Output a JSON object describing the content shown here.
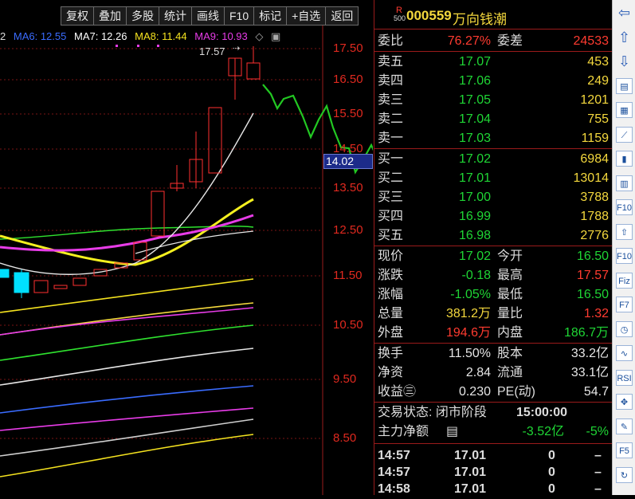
{
  "toolbar": {
    "buttons": [
      "复权",
      "叠加",
      "多股",
      "统计",
      "画线",
      "F10",
      "标记",
      "+自选",
      "返回"
    ]
  },
  "ma_legend": {
    "prefix": "2",
    "ma6_label": "MA6: 12.55",
    "ma7_label": "MA7: 12.26",
    "ma8_label": "MA8: 11.44",
    "ma9_label": "MA9: 10.93",
    "colors": {
      "ma6": "#3a6cff",
      "ma7": "#ffffff",
      "ma8": "#f4e21f",
      "ma9": "#e83ce8"
    }
  },
  "chart": {
    "high_marker": "17.57",
    "current_price_tag": "14.02",
    "price_axis": [
      "17.50",
      "16.50",
      "15.50",
      "14.50",
      "13.50",
      "12.50",
      "11.50",
      "10.50",
      "9.50",
      "8.50"
    ]
  },
  "quote": {
    "r_badge": "R",
    "r_sub": "500",
    "code": "000559",
    "name": "万向钱潮",
    "weibi_label": "委比",
    "weibi_value": "76.27%",
    "weicha_label": "委差",
    "weicha_value": "24533",
    "asks": [
      {
        "label": "卖五",
        "price": "17.07",
        "vol": "453"
      },
      {
        "label": "卖四",
        "price": "17.06",
        "vol": "249"
      },
      {
        "label": "卖三",
        "price": "17.05",
        "vol": "1201"
      },
      {
        "label": "卖二",
        "price": "17.04",
        "vol": "755"
      },
      {
        "label": "卖一",
        "price": "17.03",
        "vol": "1159"
      }
    ],
    "bids": [
      {
        "label": "买一",
        "price": "17.02",
        "vol": "6984"
      },
      {
        "label": "买二",
        "price": "17.01",
        "vol": "13014"
      },
      {
        "label": "买三",
        "price": "17.00",
        "vol": "3788"
      },
      {
        "label": "买四",
        "price": "16.99",
        "vol": "1788"
      },
      {
        "label": "买五",
        "price": "16.98",
        "vol": "2776"
      }
    ],
    "stats": [
      {
        "l1": "现价",
        "v1": "17.02",
        "c1": "green",
        "l2": "今开",
        "v2": "16.50",
        "c2": "green"
      },
      {
        "l1": "涨跌",
        "v1": "-0.18",
        "c1": "green",
        "l2": "最高",
        "v2": "17.57",
        "c2": "red"
      },
      {
        "l1": "涨幅",
        "v1": "-1.05%",
        "c1": "green",
        "l2": "最低",
        "v2": "16.50",
        "c2": "green"
      },
      {
        "l1": "总量",
        "v1": "381.2万",
        "c1": "yellow",
        "l2": "量比",
        "v2": "1.32",
        "c2": "red"
      },
      {
        "l1": "外盘",
        "v1": "194.6万",
        "c1": "red",
        "l2": "内盘",
        "v2": "186.7万",
        "c2": "green"
      }
    ],
    "stats2": [
      {
        "l1": "换手",
        "v1": "11.50%",
        "l2": "股本",
        "v2": "33.2亿"
      },
      {
        "l1": "净资",
        "v1": "2.84",
        "l2": "流通",
        "v2": "33.1亿"
      },
      {
        "l1": "收益㊂",
        "v1": "0.230",
        "l2": "PE(动)",
        "v2": "54.7"
      }
    ],
    "trade_status_label": "交易状态: 闭市阶段",
    "trade_status_time": "15:00:00",
    "main_flow_label": "主力净额",
    "main_flow_value": "-3.52亿",
    "main_flow_pct": "-5%",
    "ticks": [
      {
        "time": "14:57",
        "price": "17.01",
        "vol": "0",
        "dir": "–"
      },
      {
        "time": "14:57",
        "price": "17.01",
        "vol": "0",
        "dir": "–"
      },
      {
        "time": "14:58",
        "price": "17.01",
        "vol": "0",
        "dir": "–"
      }
    ]
  },
  "sidebar": {
    "icons": [
      "arrow-left-icon",
      "arrow-up-icon",
      "arrow-down-icon",
      "list-icon",
      "grid-icon",
      "trend-icon",
      "candles-icon",
      "table-icon",
      "f10-icon",
      "f9-icon",
      "f10b-icon",
      "fiz-icon",
      "f7-icon",
      "clock-icon",
      "wave-icon",
      "rsi-icon",
      "move-icon",
      "pen-icon",
      "f5-icon",
      "refresh-icon"
    ],
    "labels": [
      "⇦",
      "⇧",
      "⇩",
      "▤",
      "▦",
      "⟋",
      "▮",
      "▥",
      "F10",
      "⇧",
      "F10",
      "Fiz",
      "F7",
      "◷",
      "∿",
      "RSI",
      "✥",
      "✎",
      "F5",
      "↻"
    ]
  }
}
